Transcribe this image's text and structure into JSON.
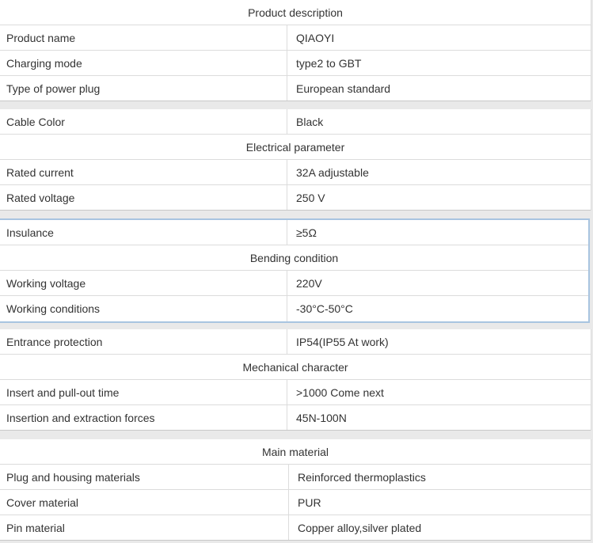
{
  "blocks": [
    {
      "rows": [
        {
          "type": "header",
          "text": "Product description"
        },
        {
          "type": "pair",
          "label": "Product name",
          "value": "QIAOYI"
        },
        {
          "type": "pair",
          "label": "Charging mode",
          "value": "type2  to GBT"
        },
        {
          "type": "pair",
          "label": "Type of power plug",
          "value": "European standard"
        }
      ]
    },
    {
      "rows": [
        {
          "type": "pair",
          "label": "Cable Color",
          "value": "Black"
        },
        {
          "type": "header",
          "text": "Electrical parameter"
        },
        {
          "type": "pair",
          "label": "Rated current",
          "value": "32A adjustable"
        },
        {
          "type": "pair",
          "label": "Rated voltage",
          "value": "250 V"
        }
      ]
    },
    {
      "rows": [
        {
          "type": "pair",
          "label": "Insulance",
          "value": "≥5Ω"
        },
        {
          "type": "header",
          "text": "Bending condition"
        },
        {
          "type": "pair",
          "label": "Working voltage",
          "value": "220V"
        },
        {
          "type": "pair",
          "label": "Working conditions",
          "value": "-30°C-50°C"
        }
      ]
    },
    {
      "rows": [
        {
          "type": "pair",
          "label": "Entrance protection",
          "value": "IP54(IP55 At work)"
        },
        {
          "type": "header",
          "text": "Mechanical character"
        },
        {
          "type": "pair",
          "label": "Insert and pull-out time",
          "value": ">1000 Come next"
        },
        {
          "type": "pair",
          "label": "Insertion and extraction forces",
          "value": "45N-100N"
        }
      ]
    },
    {
      "rows": [
        {
          "type": "header",
          "text": "Main material"
        },
        {
          "type": "pair",
          "label": "Plug and housing materials",
          "value": "Reinforced thermoplastics"
        },
        {
          "type": "pair",
          "label": "Cover material",
          "value": "PUR"
        },
        {
          "type": "pair",
          "label": "Pin material",
          "value": "Copper alloy,silver plated"
        }
      ]
    }
  ]
}
